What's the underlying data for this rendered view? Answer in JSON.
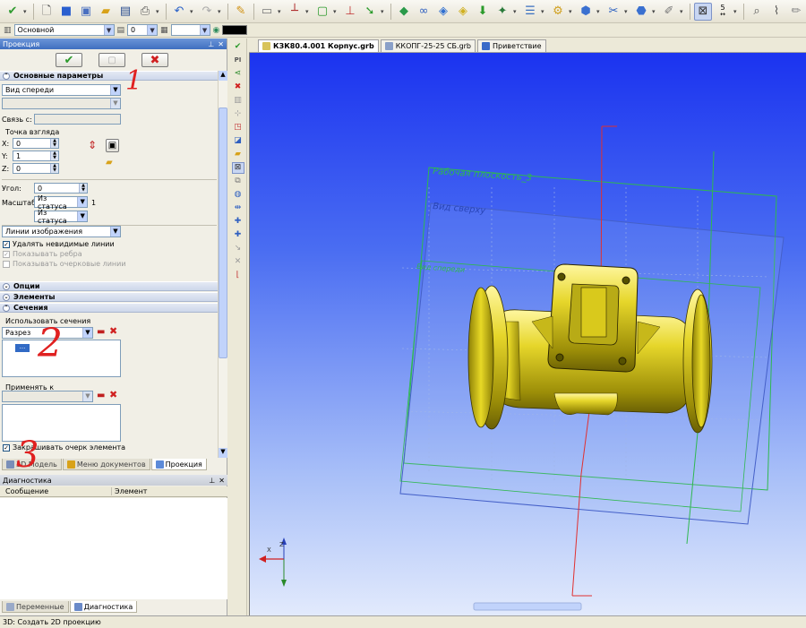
{
  "toolbar": {
    "icons": [
      "check-double-icon",
      "new-doc-icon",
      "cube-icon",
      "image-icon",
      "folder-open-icon",
      "save-icon",
      "print-icon",
      "undo-icon",
      "redo-icon",
      "pencil-icon",
      "sheet-icon",
      "axes-icon",
      "frame-icon",
      "coordinate-icon",
      "arrow-icon",
      "green-cube-icon",
      "link-icon",
      "shield-icon",
      "shield2-icon",
      "down-arrow-icon",
      "tool-icon",
      "stack-icon",
      "gear-icon",
      "cube-blue-icon",
      "wrench-icon",
      "cube-shade-icon",
      "pen-icon",
      "view-icon",
      "scale-icon",
      "doc-search-icon",
      "paperclip-icon",
      "brush-icon"
    ],
    "scale_value": "5"
  },
  "toolbar2": {
    "layer": "Основной",
    "layer_number": "0"
  },
  "panel": {
    "title": "Проекция",
    "sections": {
      "main": "Основные параметры",
      "options": "Опции",
      "elements": "Элементы",
      "sections": "Сечения"
    },
    "view_select": "Вид спереди",
    "link_label": "Связь с:",
    "viewpoint_label": "Точка взгляда",
    "x_label": "X:",
    "x_value": "0",
    "y_label": "Y:",
    "y_value": "1",
    "z_label": "Z:",
    "z_value": "0",
    "angle_label": "Угол:",
    "angle_value": "0",
    "scale_label": "Масштаб:",
    "scale_select": "Из статуса",
    "scale_ratio": "1",
    "scale_select2": "Из статуса",
    "lines_select": "Линии изображения",
    "chk_hidden": "Удалять невидимые линии",
    "chk_edges": "Показывать ребра",
    "chk_outline": "Показывать очерковые линии",
    "use_sections_label": "Использовать сечения",
    "section_select": "Разрез",
    "section_item": "...",
    "apply_to_label": "Применять к",
    "chk_hatch": "Закрашивать очерк элемента"
  },
  "left_tabs": [
    "3D Модель",
    "Меню документов",
    "Проекция"
  ],
  "diagnostics": {
    "title": "Диагностика",
    "col_message": "Сообщение",
    "col_element": "Элемент"
  },
  "bottom_tabs": [
    "Переменные",
    "Диагностика"
  ],
  "doc_tabs": [
    "КЗК80.4.001 Корпус.grb",
    "ККОПГ-25-25 СБ.grb",
    "Приветствие"
  ],
  "viewport": {
    "plane1": "Рабочая плоскость_3",
    "plane2": "Вид сверху",
    "plane3": "Вид спереди"
  },
  "annotations": [
    "1",
    "2",
    "3"
  ],
  "status": "3D: Создать 2D проекцию",
  "colors": {
    "accent": "#3f6fc0",
    "model_yellow": "#d7c80f",
    "annotation_red": "#e02020"
  }
}
